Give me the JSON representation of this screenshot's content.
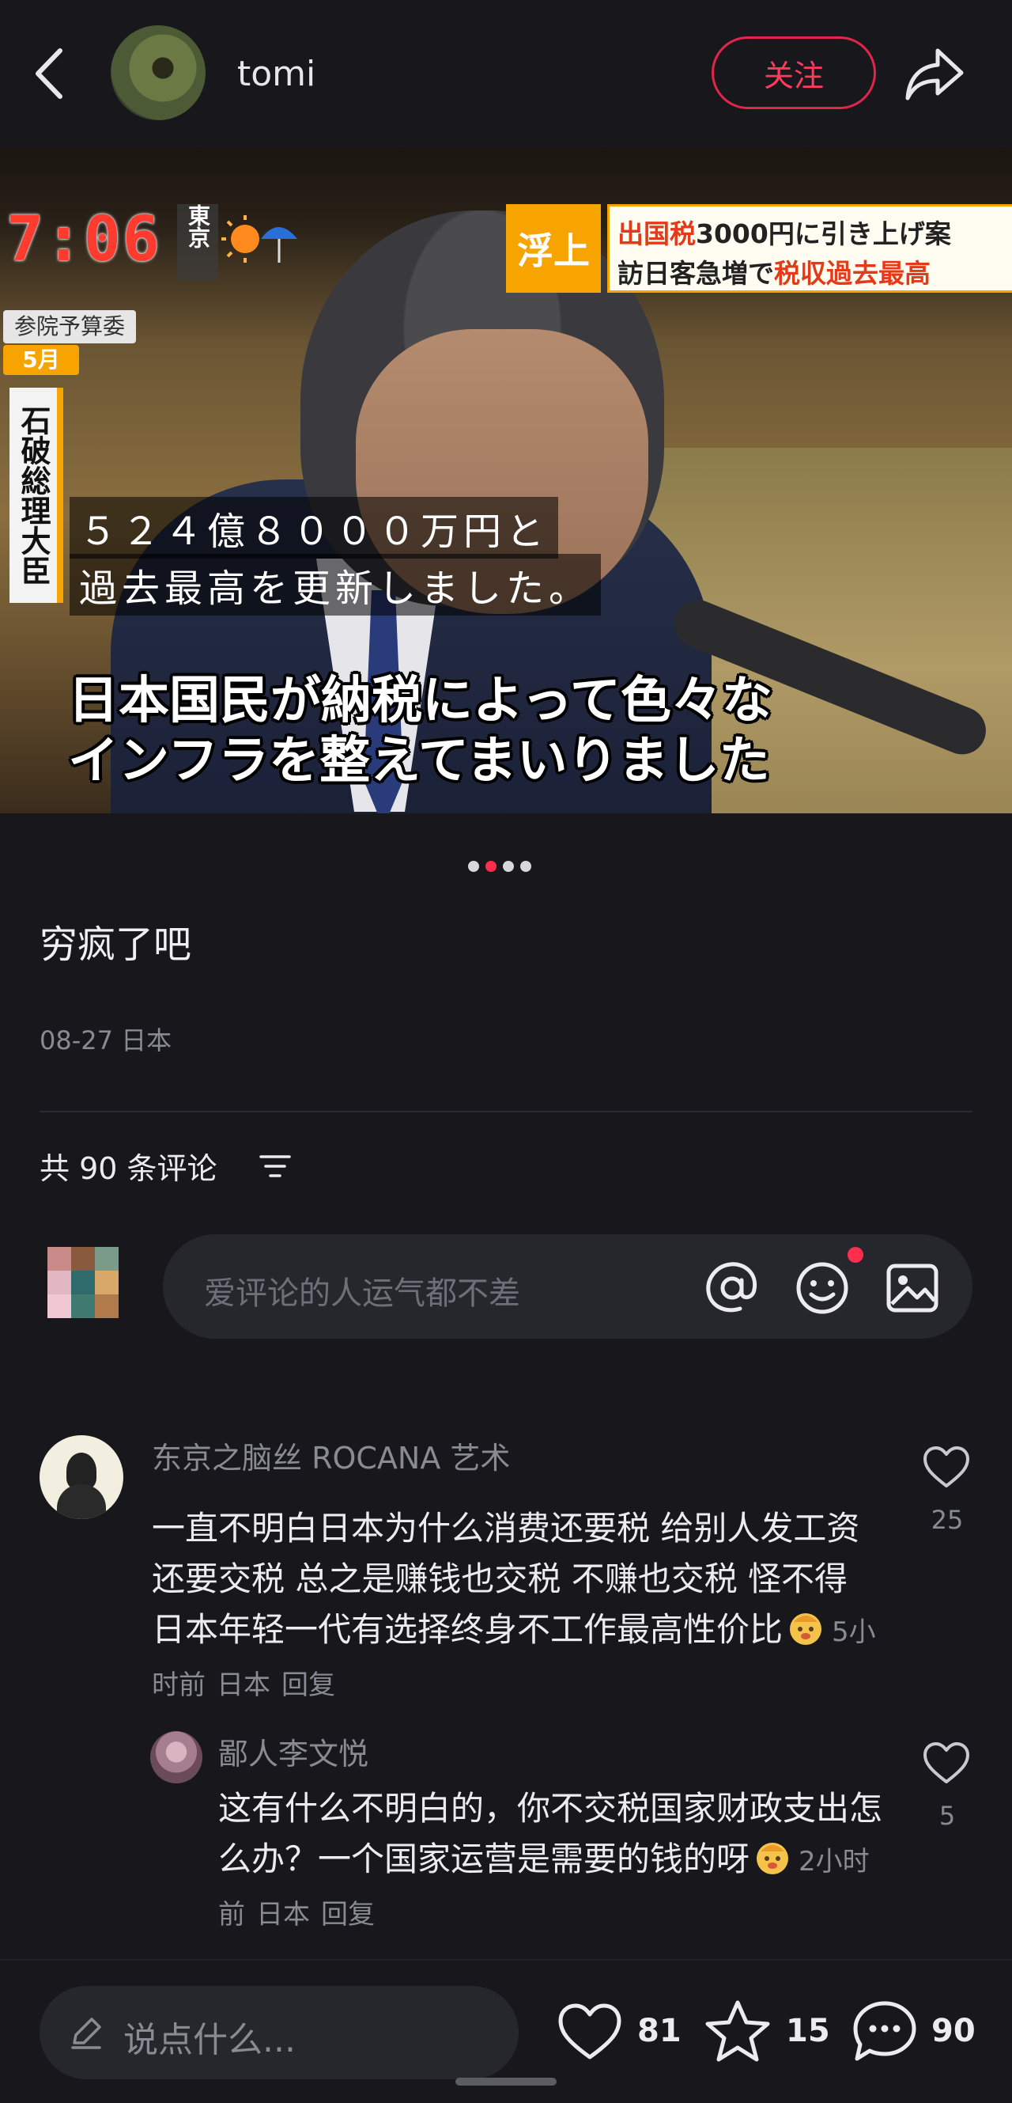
{
  "header": {
    "author_name": "tomi",
    "follow_label": "关注"
  },
  "media": {
    "clock": "7:06",
    "city": "東京",
    "badge": "浮上",
    "headline_line1_red": "出国税",
    "headline_line1_rest": "3000円に引き上げ案",
    "headline_line2_black": "訪日客急増で",
    "headline_line2_red": "税収過去最高",
    "committee": "参院予算委",
    "month": "5月",
    "speaker": "石破総理大臣",
    "subtitle1": "５２４億８０００万円と",
    "subtitle2": "過去最高を更新しました。",
    "caption1": "日本国民が納税によって色々な",
    "caption2": "インフラを整えてまいりました",
    "page_count": 4,
    "active_page": 2
  },
  "post": {
    "text": "穷疯了吧",
    "meta": "08-27 日本"
  },
  "comments_header": {
    "count_label": "共 90 条评论"
  },
  "comment_input": {
    "placeholder": "爱评论的人运气都不差"
  },
  "comments": [
    {
      "name": "东京之脑丝 ROCANA 艺术",
      "text": "一直不明白日本为什么消费还要税 给别人发工资还要交税 总之是赚钱也交税 不赚也交税 怪不得日本年轻一代有选择终身不工作最高性价比",
      "time": "5小时前",
      "location": "日本",
      "reply": "回复",
      "likes": "25"
    },
    {
      "name": "鄙人李文悦",
      "text": "这有什么不明白的，你不交税国家财政支出怎么办？一个国家运营是需要的钱的呀",
      "time": "2小时前",
      "location": "日本",
      "reply": "回复",
      "likes": "5"
    }
  ],
  "bottom_bar": {
    "placeholder": "说点什么...",
    "likes": "81",
    "stars": "15",
    "comments": "90"
  },
  "colors": {
    "accent": "#ff2e4d",
    "background": "#17171c",
    "input_bg": "#26262d"
  },
  "icons": [
    "back-icon",
    "share-icon",
    "filter-icon",
    "at-icon",
    "emoji-icon",
    "image-icon",
    "heart-icon",
    "star-icon",
    "comment-icon",
    "pencil-icon",
    "sticker-icon"
  ]
}
